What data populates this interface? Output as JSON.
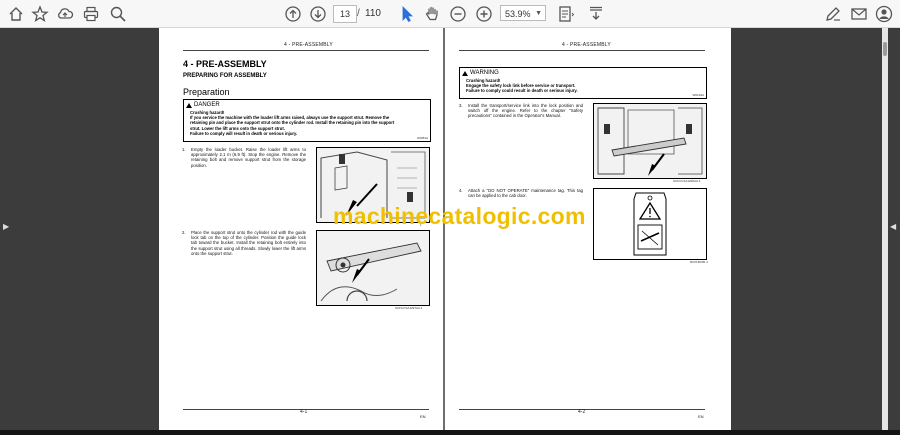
{
  "toolbar": {
    "page_current": "13",
    "page_separator": "/",
    "page_total": "110",
    "zoom": "53.9%",
    "icons": [
      "bookmark-icon",
      "cloud-upload-icon",
      "print-icon",
      "zoom-search-icon",
      "scroll-up-icon",
      "scroll-down-icon",
      "select-pointer-icon",
      "hand-tool-icon",
      "zoom-out-icon",
      "zoom-in-icon",
      "fit-page-icon",
      "download-icon",
      "sign-pen-icon",
      "email-icon",
      "account-icon"
    ]
  },
  "left_page": {
    "header": "4 - PRE-ASSEMBLY",
    "title": "4 - PRE-ASSEMBLY",
    "subtitle": "PREPARING FOR ASSEMBLY",
    "section": "Preparation",
    "danger": {
      "label": "DANGER",
      "lines": [
        "Crushing hazard!",
        "If you service the machine with the loader lift arms raised, always use the support strut. Remove the",
        "retaining pin and place the support strut onto the cylinder rod. Install the retaining pin into the support",
        "strut. Lower the lift arms onto the support strut.",
        "Failure to comply will result in death or serious injury."
      ],
      "code": "D0053A"
    },
    "steps": [
      {
        "num": "1.",
        "text": "Empty the loader bucket. Raise the loader lift arms to approximately 2.1 m (6.9 ft). Stop the engine. Remove the retaining bolt and remove support strut from the storage position."
      },
      {
        "num": "2.",
        "text": "Place the support strut onto the cylinder rod with the guide lock tab on the top of the cylinder. Position the guide lock tab toward the bucket. Install the retaining bolt entirely into the support strut using all threads. Slowly lower the lift arms onto the support strut."
      }
    ],
    "fig_codes": [
      "1",
      "SCFCCSA1297AA  2"
    ],
    "footer": "4-1",
    "lang": "EN"
  },
  "right_page": {
    "header": "4 - PRE-ASSEMBLY",
    "warning": {
      "label": "WARNING",
      "lines": [
        "Crushing hazard!",
        "Engage the safety lock link before service or transport.",
        "Failure to comply could result in death or serious injury."
      ],
      "code": "W0149A"
    },
    "steps": [
      {
        "num": "3.",
        "text": "Install the transport/service link into the lock position and switch off the engine. Refer to the chapter \"Safety precautions\" contained in the Operator's Manual."
      },
      {
        "num": "4.",
        "text": "Attach a \"DO NOT OPERATE\" maintenance tag. This tag can be applied to the cab door."
      }
    ],
    "fig_codes": [
      "SCFCCSA1296AA  3",
      "RCPH0005  4"
    ],
    "footer": "4-2",
    "lang": "EN"
  },
  "watermark": "machinecatalogic.com",
  "colors": {
    "watermark": "#f0c000",
    "viewer_bg": "#3c3c3c",
    "toolbar_bg": "#f7f7f7"
  }
}
